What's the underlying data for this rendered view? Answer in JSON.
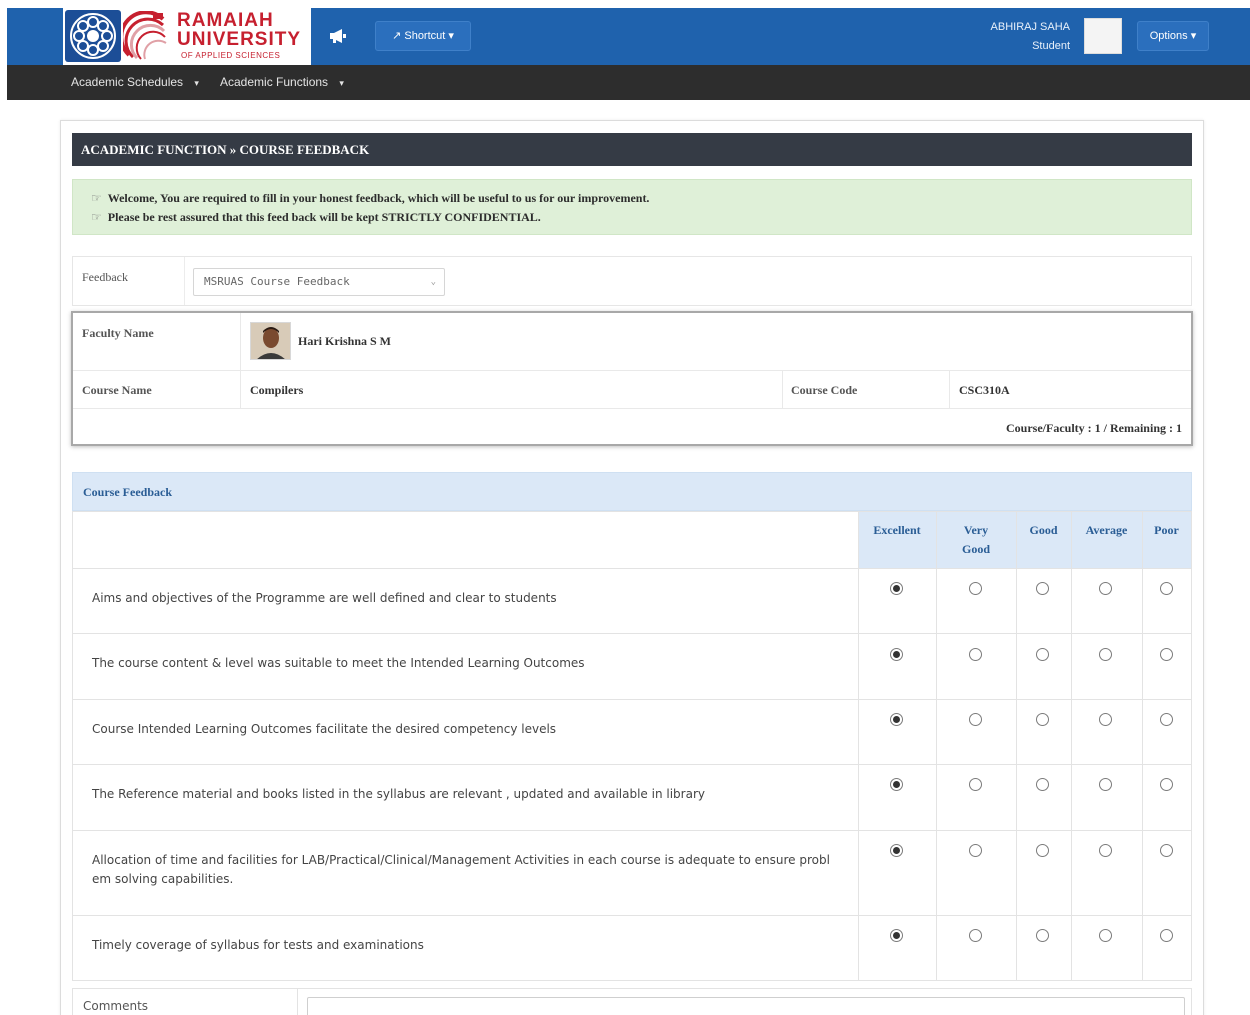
{
  "header": {
    "logo": {
      "line1": "RAMAIAH",
      "line2": "UNIVERSITY",
      "line3": "OF APPLIED SCIENCES"
    },
    "announce_icon": "megaphone-icon",
    "shortcut_label": "Shortcut",
    "user": {
      "name": "ABHIRAJ SAHA",
      "role": "Student"
    },
    "options_label": "Options",
    "brand_color": "#1f62ad"
  },
  "subnav": {
    "items": [
      {
        "label": "Academic Schedules"
      },
      {
        "label": "Academic Functions"
      }
    ]
  },
  "page": {
    "breadcrumb": "ACADEMIC FUNCTION » COURSE FEEDBACK",
    "alert_lines": [
      "Welcome, You are required to fill in your honest feedback, which will be useful to us for our improvement.",
      "Please be rest assured that this feed back will be kept STRICTLY CONFIDENTIAL."
    ],
    "feedback_label": "Feedback",
    "feedback_selected": "MSRUAS Course Feedback"
  },
  "faculty": {
    "faculty_name_label": "Faculty Name",
    "faculty_name": "Hari Krishna S M",
    "course_name_label": "Course Name",
    "course_name": "Compilers",
    "course_code_label": "Course Code",
    "course_code": "CSC310A",
    "progress": "Course/Faculty : 1 / Remaining : 1"
  },
  "course_feedback": {
    "title": "Course Feedback",
    "ratings": [
      "Excellent",
      "Very Good",
      "Good",
      "Average",
      "Poor"
    ],
    "questions": [
      {
        "text": "Aims and objectives of the Programme are well defined and clear to students",
        "selected": "Excellent"
      },
      {
        "text": "The course content & level was suitable to meet the Intended Learning Outcomes",
        "selected": "Excellent"
      },
      {
        "text": "Course Intended Learning Outcomes facilitate the desired competency levels",
        "selected": "Excellent"
      },
      {
        "text": "The Reference material and books listed in the syllabus are relevant , updated  and available in library",
        "selected": "Excellent"
      },
      {
        "text": "Allocation of time and facilities for LAB/Practical/Clinical/Management Activities in each course is adequate to ensure problem solving capabilities.",
        "selected": "Excellent"
      },
      {
        "text": "Timely coverage of syllabus for tests and examinations",
        "selected": "Excellent"
      }
    ],
    "comments_label": "Comments"
  }
}
